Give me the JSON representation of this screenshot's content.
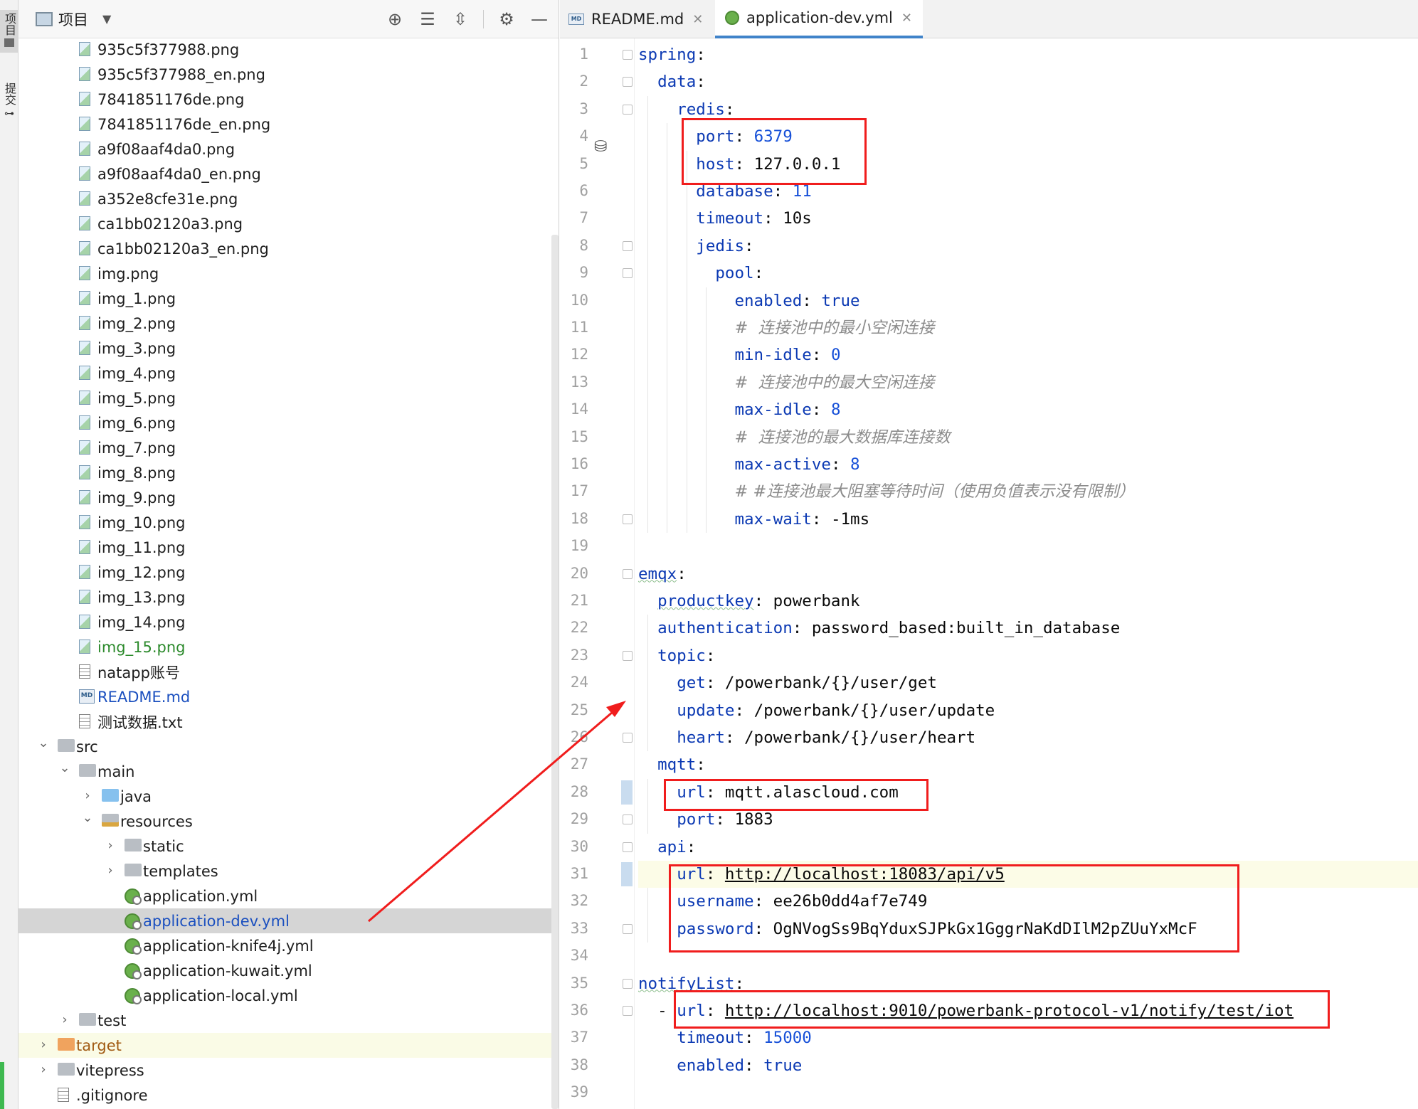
{
  "left_strip": {
    "project_label": "项目",
    "commit_label": "提交"
  },
  "project_panel": {
    "title": "项目",
    "header_icons": [
      "target-icon",
      "expand-all-icon",
      "collapse-all-icon",
      "gear-icon",
      "minimize-icon"
    ],
    "tree": [
      {
        "label": "935c5f377988.png",
        "type": "image",
        "level": 3
      },
      {
        "label": "935c5f377988_en.png",
        "type": "image",
        "level": 3
      },
      {
        "label": "7841851176de.png",
        "type": "image",
        "level": 3
      },
      {
        "label": "7841851176de_en.png",
        "type": "image",
        "level": 3
      },
      {
        "label": "a9f08aaf4da0.png",
        "type": "image",
        "level": 3
      },
      {
        "label": "a9f08aaf4da0_en.png",
        "type": "image",
        "level": 3
      },
      {
        "label": "a352e8cfe31e.png",
        "type": "image",
        "level": 3
      },
      {
        "label": "ca1bb02120a3.png",
        "type": "image",
        "level": 3
      },
      {
        "label": "ca1bb02120a3_en.png",
        "type": "image",
        "level": 3
      },
      {
        "label": "img.png",
        "type": "image",
        "level": 3
      },
      {
        "label": "img_1.png",
        "type": "image",
        "level": 3
      },
      {
        "label": "img_2.png",
        "type": "image",
        "level": 3
      },
      {
        "label": "img_3.png",
        "type": "image",
        "level": 3
      },
      {
        "label": "img_4.png",
        "type": "image",
        "level": 3
      },
      {
        "label": "img_5.png",
        "type": "image",
        "level": 3
      },
      {
        "label": "img_6.png",
        "type": "image",
        "level": 3
      },
      {
        "label": "img_7.png",
        "type": "image",
        "level": 3
      },
      {
        "label": "img_8.png",
        "type": "image",
        "level": 3
      },
      {
        "label": "img_9.png",
        "type": "image",
        "level": 3
      },
      {
        "label": "img_10.png",
        "type": "image",
        "level": 3
      },
      {
        "label": "img_11.png",
        "type": "image",
        "level": 3
      },
      {
        "label": "img_12.png",
        "type": "image",
        "level": 3
      },
      {
        "label": "img_13.png",
        "type": "image",
        "level": 3
      },
      {
        "label": "img_14.png",
        "type": "image",
        "level": 3
      },
      {
        "label": "img_15.png",
        "type": "image",
        "level": 3,
        "color": "green"
      },
      {
        "label": "natapp账号",
        "type": "text",
        "level": 3
      },
      {
        "label": "README.md",
        "type": "md",
        "level": 3,
        "color": "blue"
      },
      {
        "label": "测试数据.txt",
        "type": "text",
        "level": 3
      },
      {
        "label": "src",
        "type": "folder",
        "level": 2,
        "expanded": true
      },
      {
        "label": "main",
        "type": "folder",
        "level": 3,
        "expanded": true
      },
      {
        "label": "java",
        "type": "folder-blue",
        "level": 4,
        "expanded": false
      },
      {
        "label": "resources",
        "type": "folder-res",
        "level": 4,
        "expanded": true
      },
      {
        "label": "static",
        "type": "folder",
        "level": 5,
        "expanded": false
      },
      {
        "label": "templates",
        "type": "folder",
        "level": 5,
        "expanded": false
      },
      {
        "label": "application.yml",
        "type": "yml",
        "level": 5
      },
      {
        "label": "application-dev.yml",
        "type": "yml",
        "level": 5,
        "color": "blue",
        "selected": true
      },
      {
        "label": "application-knife4j.yml",
        "type": "yml",
        "level": 5
      },
      {
        "label": "application-kuwait.yml",
        "type": "yml",
        "level": 5
      },
      {
        "label": "application-local.yml",
        "type": "yml",
        "level": 5
      },
      {
        "label": "test",
        "type": "folder",
        "level": 3,
        "expanded": false
      },
      {
        "label": "target",
        "type": "folder-orange",
        "level": 2,
        "expanded": false,
        "color": "orange",
        "highlight": true
      },
      {
        "label": "vitepress",
        "type": "folder",
        "level": 2,
        "expanded": false
      },
      {
        "label": ".gitignore",
        "type": "text",
        "level": 2
      }
    ]
  },
  "editor": {
    "tabs": [
      {
        "label": "README.md",
        "icon": "markdown-icon",
        "active": false
      },
      {
        "label": "application-dev.yml",
        "icon": "yaml-icon",
        "active": true
      }
    ],
    "lines": [
      {
        "n": "1",
        "indent": 0,
        "key": "spring",
        "sep": ":",
        "value": "",
        "vclass": "v"
      },
      {
        "n": "2",
        "indent": 1,
        "key": "data",
        "sep": ":",
        "value": "",
        "vclass": "v"
      },
      {
        "n": "3",
        "indent": 2,
        "key": "redis",
        "sep": ":",
        "value": "",
        "vclass": "v"
      },
      {
        "n": "4",
        "indent": 3,
        "key": "port",
        "sep": ": ",
        "value": "6379",
        "vclass": "n"
      },
      {
        "n": "5",
        "indent": 3,
        "key": "host",
        "sep": ": ",
        "value": "127.0.0.1",
        "vclass": "v"
      },
      {
        "n": "6",
        "indent": 3,
        "key": "database",
        "sep": ": ",
        "value": "11",
        "vclass": "n"
      },
      {
        "n": "7",
        "indent": 3,
        "key": "timeout",
        "sep": ": ",
        "value": "10s",
        "vclass": "v"
      },
      {
        "n": "8",
        "indent": 3,
        "key": "jedis",
        "sep": ":",
        "value": "",
        "vclass": "v"
      },
      {
        "n": "9",
        "indent": 4,
        "key": "pool",
        "sep": ":",
        "value": "",
        "vclass": "v"
      },
      {
        "n": "10",
        "indent": 5,
        "key": "enabled",
        "sep": ": ",
        "value": "true",
        "vclass": "b"
      },
      {
        "n": "11",
        "indent": 5,
        "comment": "#  连接池中的最小空闲连接"
      },
      {
        "n": "12",
        "indent": 5,
        "key": "min-idle",
        "sep": ": ",
        "value": "0",
        "vclass": "n"
      },
      {
        "n": "13",
        "indent": 5,
        "comment": "#  连接池中的最大空闲连接"
      },
      {
        "n": "14",
        "indent": 5,
        "key": "max-idle",
        "sep": ": ",
        "value": "8",
        "vclass": "n"
      },
      {
        "n": "15",
        "indent": 5,
        "comment": "#  连接池的最大数据库连接数"
      },
      {
        "n": "16",
        "indent": 5,
        "key": "max-active",
        "sep": ": ",
        "value": "8",
        "vclass": "n"
      },
      {
        "n": "17",
        "indent": 5,
        "comment": "# #连接池最大阻塞等待时间（使用负值表示没有限制）"
      },
      {
        "n": "18",
        "indent": 5,
        "key": "max-wait",
        "sep": ": ",
        "value": "-1ms",
        "vclass": "v"
      },
      {
        "n": "19",
        "indent": 0,
        "key": "",
        "sep": "",
        "value": "",
        "vclass": "v"
      },
      {
        "n": "20",
        "indent": 0,
        "key": "emqx",
        "sep": ":",
        "value": "",
        "vclass": "v",
        "wavy": true
      },
      {
        "n": "21",
        "indent": 1,
        "key": "productkey",
        "sep": ": ",
        "value": "powerbank",
        "vclass": "v",
        "wavy": true
      },
      {
        "n": "22",
        "indent": 1,
        "key": "authentication",
        "sep": ": ",
        "value": "password_based:built_in_database",
        "vclass": "v"
      },
      {
        "n": "23",
        "indent": 1,
        "key": "topic",
        "sep": ":",
        "value": "",
        "vclass": "v"
      },
      {
        "n": "24",
        "indent": 2,
        "key": "get",
        "sep": ": ",
        "value": "/powerbank/{}/user/get",
        "vclass": "v"
      },
      {
        "n": "25",
        "indent": 2,
        "key": "update",
        "sep": ": ",
        "value": "/powerbank/{}/user/update",
        "vclass": "v"
      },
      {
        "n": "26",
        "indent": 2,
        "key": "heart",
        "sep": ": ",
        "value": "/powerbank/{}/user/heart",
        "vclass": "v"
      },
      {
        "n": "27",
        "indent": 1,
        "key": "mqtt",
        "sep": ":",
        "value": "",
        "vclass": "v"
      },
      {
        "n": "28",
        "indent": 2,
        "key": "url",
        "sep": ": ",
        "value": "mqtt.alascloud.com",
        "vclass": "v"
      },
      {
        "n": "29",
        "indent": 2,
        "key": "port",
        "sep": ": ",
        "value": "1883",
        "vclass": "v"
      },
      {
        "n": "30",
        "indent": 1,
        "key": "api",
        "sep": ":",
        "value": "",
        "vclass": "v"
      },
      {
        "n": "31",
        "indent": 2,
        "key": "url",
        "sep": ": ",
        "value": "http://localhost:18083/api/v5",
        "vclass": "v",
        "underline": true,
        "active": true
      },
      {
        "n": "32",
        "indent": 2,
        "key": "username",
        "sep": ": ",
        "value": "ee26b0dd4af7e749",
        "vclass": "v"
      },
      {
        "n": "33",
        "indent": 2,
        "key": "password",
        "sep": ": ",
        "value": "OgNVogSs9BqYduxSJPkGx1GggrNaKdDIlM2pZUuYxMcF",
        "vclass": "v"
      },
      {
        "n": "34",
        "indent": 0,
        "key": "",
        "sep": "",
        "value": "",
        "vclass": "v"
      },
      {
        "n": "35",
        "indent": 0,
        "key": "notifyList",
        "sep": ":",
        "value": "",
        "vclass": "v",
        "wavy": true
      },
      {
        "n": "36",
        "indent": 1,
        "dash": true,
        "key": "url",
        "sep": ": ",
        "value": "http://localhost:9010/powerbank-protocol-v1/notify/test/iot",
        "vclass": "v",
        "underline": true
      },
      {
        "n": "37",
        "indent": 2,
        "key": "timeout",
        "sep": ": ",
        "value": "15000",
        "vclass": "n"
      },
      {
        "n": "38",
        "indent": 2,
        "key": "enabled",
        "sep": ": ",
        "value": "true",
        "vclass": "b"
      },
      {
        "n": "39",
        "indent": 0,
        "key": "",
        "sep": "",
        "value": "",
        "vclass": "v"
      }
    ]
  },
  "annotation_colors": {
    "red_box": "#f01d1d",
    "arrow": "#f01d1d"
  }
}
